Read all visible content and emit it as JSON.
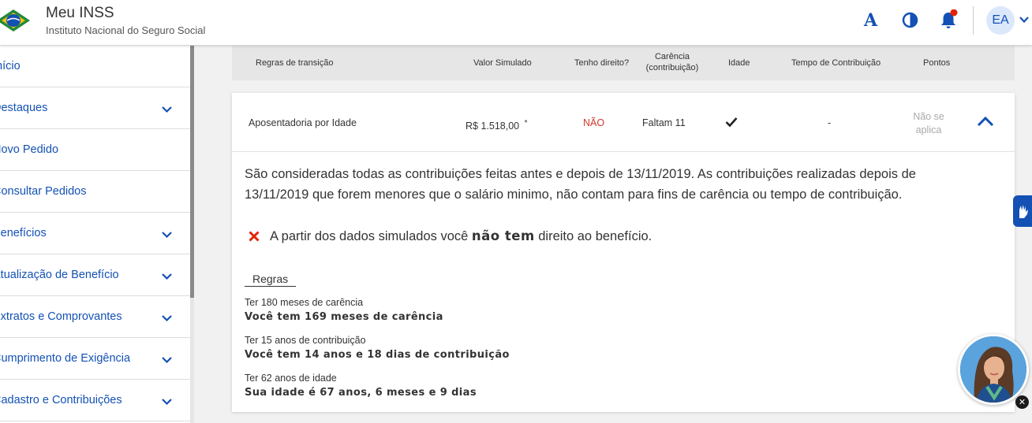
{
  "header": {
    "app_title": "Meu INSS",
    "app_subtitle": "Instituto Nacional do Seguro Social",
    "font_size_button": "A",
    "avatar_initials": "EA",
    "accent_color": "#1351b4",
    "notification_dot_color": "#e52207"
  },
  "sidebar": {
    "items": [
      {
        "label": "Início",
        "expandable": false
      },
      {
        "label": "Destaques",
        "expandable": true
      },
      {
        "label": "Novo Pedido",
        "expandable": false
      },
      {
        "label": "Consultar Pedidos",
        "expandable": false
      },
      {
        "label": "Benefícios",
        "expandable": true
      },
      {
        "label": "Atualização de Benefício",
        "expandable": true
      },
      {
        "label": "Extratos e Comprovantes",
        "expandable": true
      },
      {
        "label": "Cumprimento de Exigência",
        "expandable": true
      },
      {
        "label": "Cadastro e Contribuições",
        "expandable": true
      }
    ]
  },
  "table": {
    "headers": {
      "regras": "Regras de transição",
      "valor": "Valor Simulado",
      "direito": "Tenho direito?",
      "carencia_l1": "Carência",
      "carencia_l2": "(contribuição)",
      "idade": "Idade",
      "tempo": "Tempo de Contribuição",
      "pontos": "Pontos"
    },
    "row": {
      "regra": "Aposentadoria por Idade",
      "valor": "R$ 1.518,00",
      "valor_note": "*",
      "direito": "NÃO",
      "carencia": "Faltam 11",
      "idade_icon": "check-icon",
      "tempo": "-",
      "pontos_l1": "Não se",
      "pontos_l2": "aplica"
    }
  },
  "detail": {
    "paragraph": "São consideradas todas as contribuições feitas antes e depois de 13/11/2019. As contribuições realizadas depois de 13/11/2019 que forem menores que o salário minimo, não contam para fins de carência ou tempo de contribuição.",
    "result_prefix": "A partir dos dados simulados você",
    "result_strong": "não tem",
    "result_suffix": "direito ao benefício.",
    "regras_title": "Regras",
    "rules": [
      {
        "label": "Ter 180 meses de carência",
        "value": "Você tem 169 meses de carência"
      },
      {
        "label": "Ter 15 anos de contribuição",
        "value": "Você tem 14 anos e 18 dias de contribuição"
      },
      {
        "label": "Ter 62 anos de idade",
        "value": "Sua idade é 67 anos, 6 meses e 9 dias"
      }
    ]
  }
}
